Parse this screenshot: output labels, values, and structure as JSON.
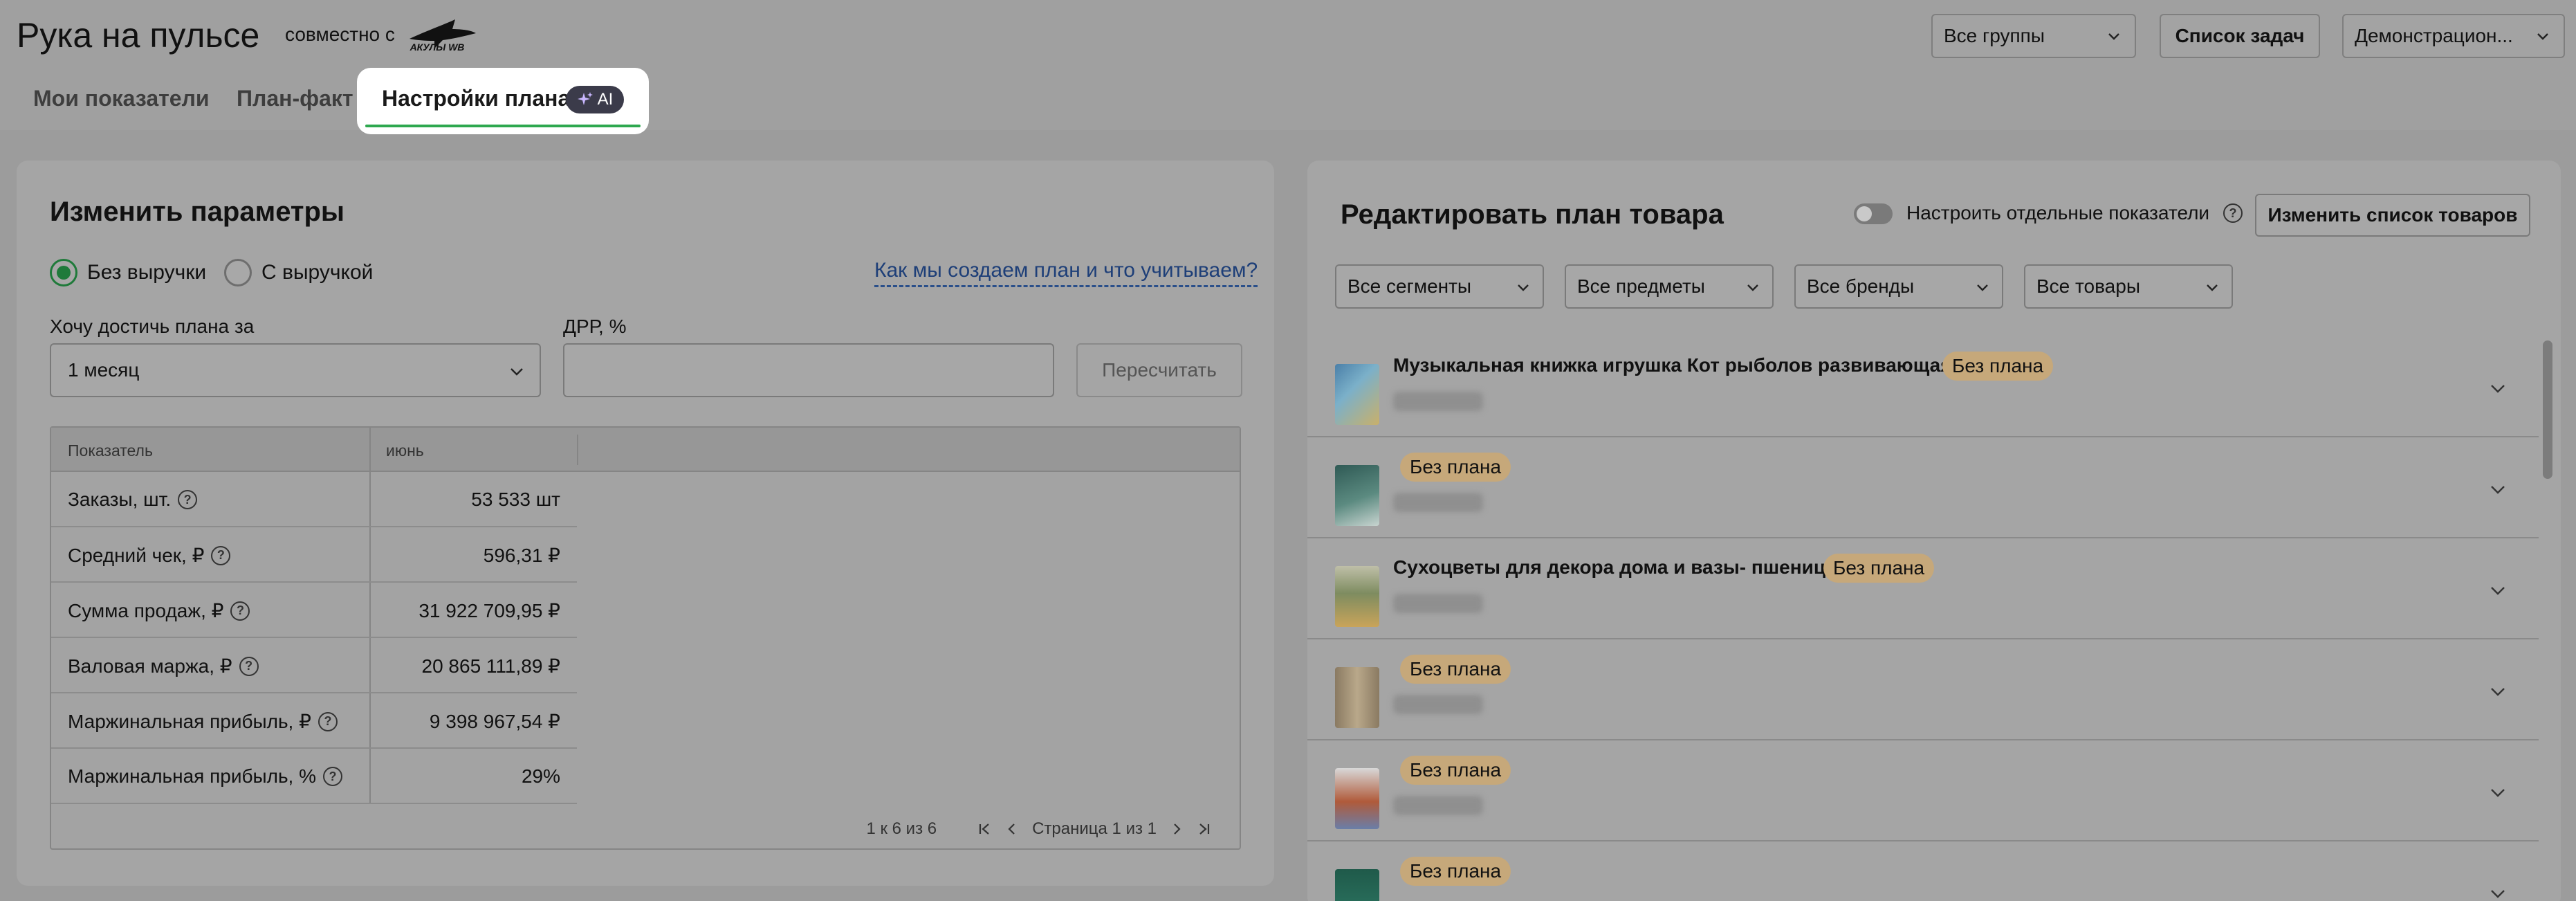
{
  "header": {
    "app_title": "Рука на пульсе",
    "partner_text": "совместно с",
    "partner_logo_text": "АКУЛЫ WB",
    "groups_select": "Все группы",
    "tasks_button": "Список задач",
    "account_select": "Демонстрацион..."
  },
  "tabs": [
    {
      "label": "Мои показатели"
    },
    {
      "label": "План-факт"
    },
    {
      "label": "Настройки плана",
      "badge": "AI",
      "active": true
    }
  ],
  "left": {
    "title": "Изменить параметры",
    "radio_no_revenue": "Без выручки",
    "radio_with_revenue": "С выручкой",
    "how_link": "Как мы создаем план и что учитываем?",
    "period_label": "Хочу достичь плана за",
    "period_value": "1 месяц",
    "drr_label": "ДРР, %",
    "drr_value": "",
    "recalc_button": "Пересчитать",
    "table": {
      "col_metric": "Показатель",
      "col_month": "июнь",
      "rows": [
        {
          "name": "Заказы, шт.",
          "value": "53 533 шт"
        },
        {
          "name": "Средний чек, ₽",
          "value": "596,31 ₽"
        },
        {
          "name": "Сумма продаж, ₽",
          "value": "31 922 709,95 ₽"
        },
        {
          "name": "Валовая маржа, ₽",
          "value": "20 865 111,89 ₽"
        },
        {
          "name": "Маржинальная прибыль, ₽",
          "value": "9 398 967,54 ₽"
        },
        {
          "name": "Маржинальная прибыль, %",
          "value": "29%"
        }
      ],
      "range_text": "1 к 6 из 6",
      "page_text": "Страница 1 из 1"
    }
  },
  "right": {
    "title": "Редактировать план товара",
    "toggle_label": "Настроить отдельные показатели",
    "change_list_button": "Изменить список товаров",
    "filters": [
      "Все сегменты",
      "Все предметы",
      "Все бренды",
      "Все товары"
    ],
    "no_plan_label": "Без плана",
    "products": [
      {
        "name": "Музыкальная книжка игрушка Кот рыболов развивающая"
      },
      {
        "name": ""
      },
      {
        "name": "Сухоцветы для декора дома и вазы- пшеница"
      },
      {
        "name": ""
      },
      {
        "name": ""
      },
      {
        "name": ""
      }
    ]
  },
  "colors": {
    "accent_green": "#2ea84f",
    "badge_bg": "#c6a87a",
    "link_blue": "#1e3f78"
  }
}
